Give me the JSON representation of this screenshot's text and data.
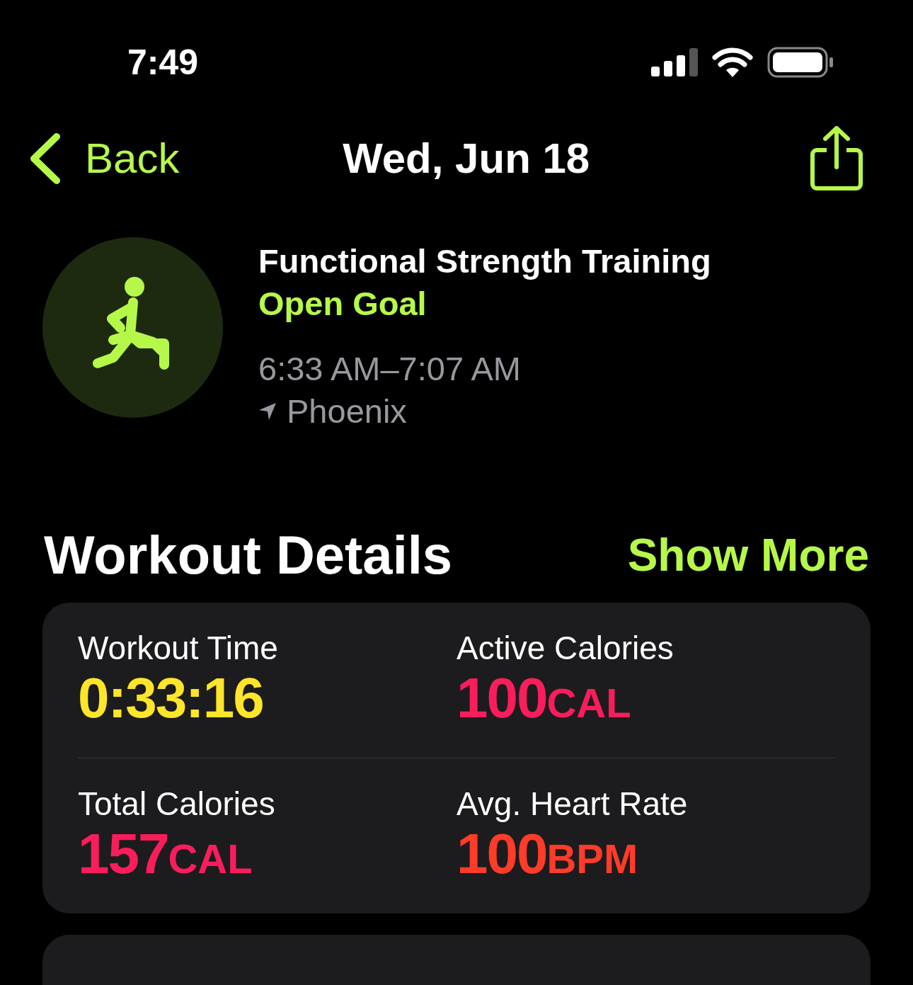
{
  "status_bar": {
    "time": "7:49"
  },
  "nav": {
    "back": "Back",
    "title": "Wed, Jun 18"
  },
  "workout": {
    "name": "Functional Strength Training",
    "goal": "Open Goal",
    "time_range": "6:33 AM–7:07 AM",
    "location": "Phoenix"
  },
  "section": {
    "title": "Workout Details",
    "action": "Show More"
  },
  "metrics": [
    {
      "label": "Workout Time",
      "value": "0:33:16",
      "color": "#fde52a"
    },
    {
      "label": "Active Calories",
      "value": "100",
      "unit": "CAL",
      "color": "#fa1d5b"
    },
    {
      "label": "Total Calories",
      "value": "157",
      "unit": "CAL",
      "color": "#fa1d5b"
    },
    {
      "label": "Avg. Heart Rate",
      "value": "100",
      "unit": "BPM",
      "color": "#ff3b2a"
    }
  ]
}
